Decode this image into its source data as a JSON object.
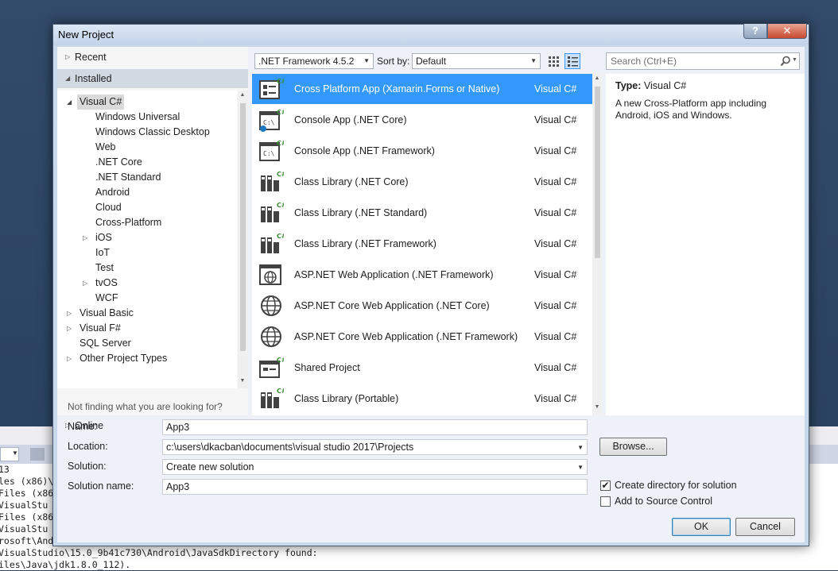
{
  "dialog": {
    "title": "New Project",
    "help_glyph": "?",
    "close_glyph": "✕"
  },
  "left_pane": {
    "recent": "Recent",
    "installed": "Installed",
    "online": "Online",
    "not_finding": "Not finding what you are looking for?",
    "tree": [
      {
        "label": "Visual C#",
        "level": 0,
        "expander": "expanded",
        "selected": true
      },
      {
        "label": "Windows Universal",
        "level": 1,
        "expander": "none"
      },
      {
        "label": "Windows Classic Desktop",
        "level": 1,
        "expander": "none"
      },
      {
        "label": "Web",
        "level": 1,
        "expander": "none"
      },
      {
        "label": ".NET Core",
        "level": 1,
        "expander": "none"
      },
      {
        "label": ".NET Standard",
        "level": 1,
        "expander": "none"
      },
      {
        "label": "Android",
        "level": 1,
        "expander": "none"
      },
      {
        "label": "Cloud",
        "level": 1,
        "expander": "none"
      },
      {
        "label": "Cross-Platform",
        "level": 1,
        "expander": "none"
      },
      {
        "label": "iOS",
        "level": 1,
        "expander": "collapsed"
      },
      {
        "label": "IoT",
        "level": 1,
        "expander": "none"
      },
      {
        "label": "Test",
        "level": 1,
        "expander": "none"
      },
      {
        "label": "tvOS",
        "level": 1,
        "expander": "collapsed"
      },
      {
        "label": "WCF",
        "level": 1,
        "expander": "none"
      },
      {
        "label": "Visual Basic",
        "level": 0,
        "expander": "collapsed"
      },
      {
        "label": "Visual F#",
        "level": 0,
        "expander": "collapsed"
      },
      {
        "label": "SQL Server",
        "level": 0,
        "expander": "none"
      },
      {
        "label": "Other Project Types",
        "level": 0,
        "expander": "collapsed"
      }
    ]
  },
  "toolbar": {
    "framework": ".NET Framework 4.5.2",
    "sort_label": "Sort by:",
    "sort_value": "Default",
    "search_placeholder": "Search (Ctrl+E)"
  },
  "templates": [
    {
      "name": "Cross Platform App (Xamarin.Forms or Native)",
      "language": "Visual C#",
      "icon": "xamarin-forms-icon",
      "selected": true
    },
    {
      "name": "Console App (.NET Core)",
      "language": "Visual C#",
      "icon": "console-core-icon"
    },
    {
      "name": "Console App (.NET Framework)",
      "language": "Visual C#",
      "icon": "console-framework-icon"
    },
    {
      "name": "Class Library (.NET Core)",
      "language": "Visual C#",
      "icon": "class-library-icon"
    },
    {
      "name": "Class Library (.NET Standard)",
      "language": "Visual C#",
      "icon": "class-library-icon"
    },
    {
      "name": "Class Library (.NET Framework)",
      "language": "Visual C#",
      "icon": "class-library-icon"
    },
    {
      "name": "ASP.NET Web Application (.NET Framework)",
      "language": "Visual C#",
      "icon": "web-application-icon"
    },
    {
      "name": "ASP.NET Core Web Application (.NET Core)",
      "language": "Visual C#",
      "icon": "globe-icon"
    },
    {
      "name": "ASP.NET Core Web Application (.NET Framework)",
      "language": "Visual C#",
      "icon": "globe-icon"
    },
    {
      "name": "Shared Project",
      "language": "Visual C#",
      "icon": "shared-project-icon"
    },
    {
      "name": "Class Library (Portable)",
      "language": "Visual C#",
      "icon": "class-library-icon"
    }
  ],
  "details": {
    "type_label": "Type:",
    "type_value": "Visual C#",
    "description": "A new Cross-Platform app including Android, iOS and Windows."
  },
  "form": {
    "name_label": "Name:",
    "name_value": "App3",
    "location_label": "Location:",
    "location_value": "c:\\users\\dkacban\\documents\\visual studio 2017\\Projects",
    "solution_label": "Solution:",
    "solution_value": "Create new solution",
    "solution_name_label": "Solution name:",
    "solution_name_value": "App3",
    "browse_label": "Browse...",
    "create_dir_label": "Create directory for solution",
    "create_dir_checked": true,
    "source_control_label": "Add to Source Control",
    "source_control_checked": false,
    "ok_label": "OK",
    "cancel_label": "Cancel"
  },
  "background_output": {
    "combo_value": "",
    "lines": [
      "13",
      "les (x86)\\",
      "Files (x86",
      "VisualStu",
      "Files (x86",
      "VisualStu",
      "rosoft\\And",
      "VisualStudio\\15.0_9b41c730\\Android\\JavaSdkDirectory found:",
      "iles\\Java\\jdk1.8.0_112)."
    ]
  },
  "colors": {
    "selection": "#3399ff",
    "dialog_frame": "#c9d9ec",
    "ide_background": "#2d4560"
  }
}
